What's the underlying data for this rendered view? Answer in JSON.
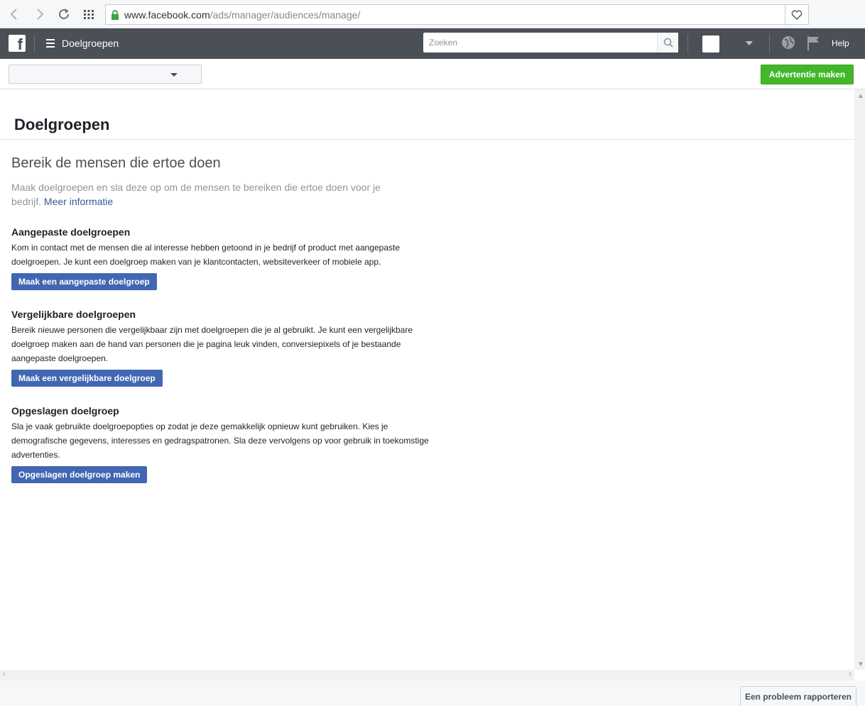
{
  "browser": {
    "url_host": "www.facebook.com",
    "url_path": "/ads/manager/audiences/manage/"
  },
  "header": {
    "logo": "f",
    "title": "Doelgroepen",
    "search_placeholder": "Zoeken",
    "help_label": "Help"
  },
  "subheader": {
    "account_select_value": "",
    "create_ad_label": "Advertentie maken"
  },
  "main": {
    "page_title": "Doelgroepen",
    "intro_heading": "Bereik de mensen die ertoe doen",
    "intro_text": "Maak doelgroepen en sla deze op om de mensen te bereiken die ertoe doen voor je bedrijf.",
    "intro_link": "Meer informatie",
    "sections": [
      {
        "title": "Aangepaste doelgroepen",
        "text": "Kom in contact met de mensen die al interesse hebben getoond in je bedrijf of product met aangepaste doelgroepen. Je kunt een doelgroep maken van je klantcontacten, websiteverkeer of mobiele app.",
        "button": "Maak een aangepaste doelgroep"
      },
      {
        "title": "Vergelijkbare doelgroepen",
        "text": "Bereik nieuwe personen die vergelijkbaar zijn met doelgroepen die je al gebruikt. Je kunt een vergelijkbare doelgroep maken aan de hand van personen die je pagina leuk vinden, conversiepixels of je bestaande aangepaste doelgroepen.",
        "button": "Maak een vergelijkbare doelgroep"
      },
      {
        "title": "Opgeslagen doelgroep",
        "text": "Sla je vaak gebruikte doelgroepopties op zodat je deze gemakkelijk opnieuw kunt gebruiken. Kies je demografische gegevens, interesses en gedragspatronen. Sla deze vervolgens op voor gebruik in toekomstige advertenties.",
        "button": "Opgeslagen doelgroep maken"
      }
    ]
  },
  "footer": {
    "report_label": "Een probleem rapporteren"
  },
  "colors": {
    "header_bg": "#4b4f56",
    "primary_button": "#4267b2",
    "create_button": "#42b72a",
    "link": "#365899"
  }
}
